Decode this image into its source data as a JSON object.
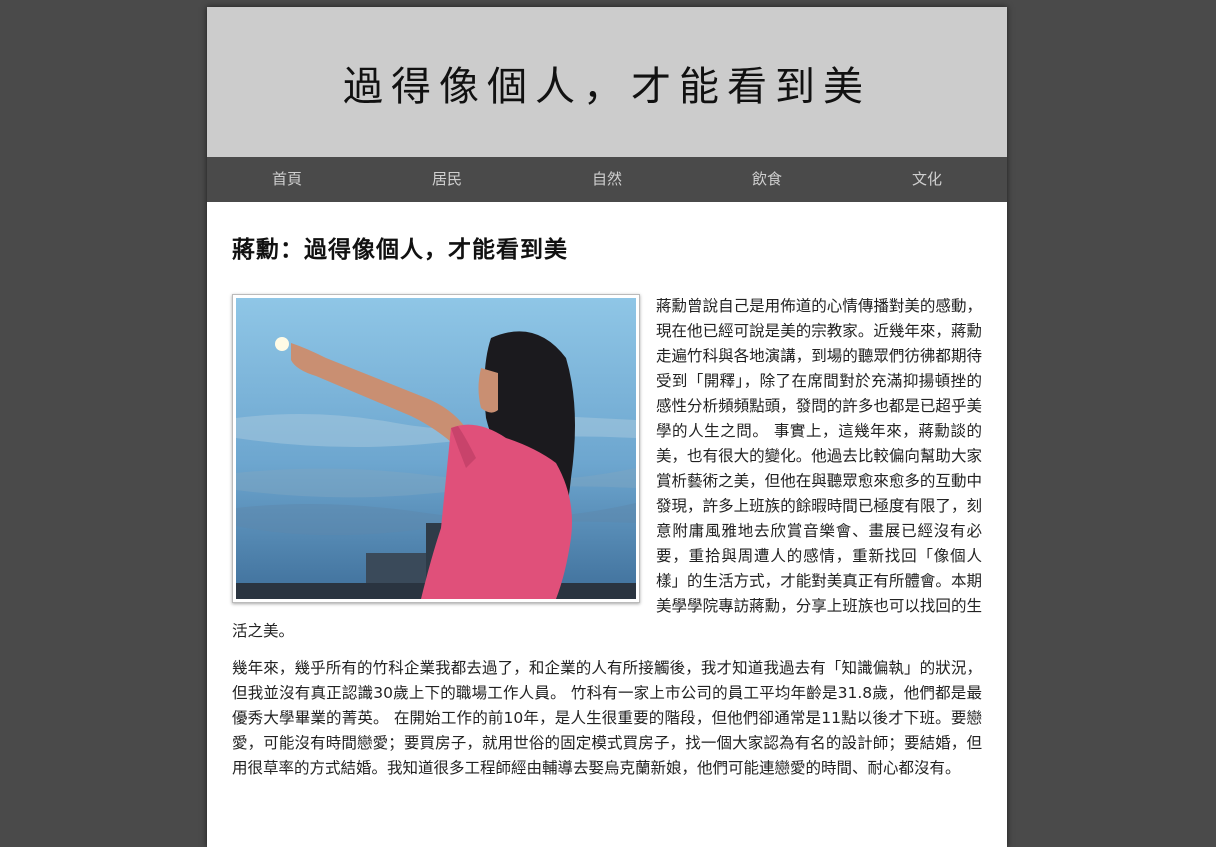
{
  "site": {
    "banner_title": "過得像個人，才能看到美"
  },
  "nav": {
    "items": [
      {
        "label": "首頁"
      },
      {
        "label": "居民"
      },
      {
        "label": "自然"
      },
      {
        "label": "飲食"
      },
      {
        "label": "文化"
      }
    ]
  },
  "article": {
    "title": "蔣勳：過得像個人，才能看到美",
    "paragraphs": [
      "蔣勳曾說自己是用佈道的心情傳播對美的感動，現在他已經可說是美的宗教家。近幾年來，蔣勳走遍竹科與各地演講，到場的聽眾們彷彿都期待受到「開釋」，除了在席間對於充滿抑揚頓挫的感性分析頻頻點頭，發問的許多也都是已超乎美學的人生之問。 事實上，這幾年來，蔣勳談的美，也有很大的變化。他過去比較偏向幫助大家賞析藝術之美，但他在與聽眾愈來愈多的互動中發現，許多上班族的餘暇時間已極度有限了，刻意附庸風雅地去欣賞音樂會、畫展已經沒有必要，重拾與周遭人的感情，重新找回「像個人樣」的生活方式，才能對美真正有所體會。本期美學學院專訪蔣勳，分享上班族也可以找回的生活之美。",
      "幾年來，幾乎所有的竹科企業我都去過了，和企業的人有所接觸後，我才知道我過去有「知識偏執」的狀況，但我並沒有真正認識30歲上下的職場工作人員。 竹科有一家上市公司的員工平均年齡是31.8歲，他們都是最優秀大學畢業的菁英。 在開始工作的前10年，是人生很重要的階段，但他們卻通常是11點以後才下班。要戀愛，可能沒有時間戀愛；要買房子，就用世俗的固定模式買房子，找一個大家認為有名的設計師；要結婚，但用很草率的方式結婚。我知道很多工程師經由輔導去娶烏克蘭新娘，他們可能連戀愛的時間、耐心都沒有。"
    ]
  },
  "colors": {
    "background": "#4a4a4a",
    "banner": "#cccccc",
    "nav": "#4a4a4a",
    "nav_text": "#cfcfcf"
  }
}
